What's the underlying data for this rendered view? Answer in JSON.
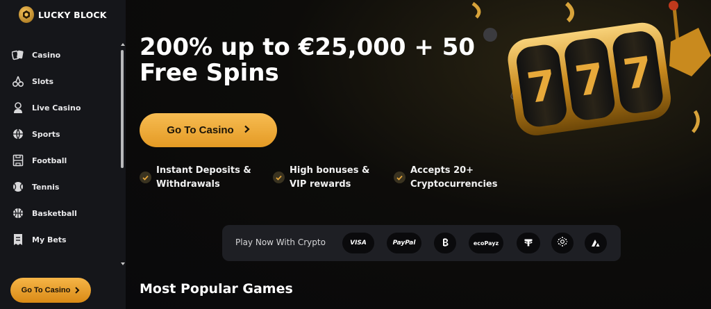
{
  "sidebar": {
    "logo_text": "LUCKY BLOCK",
    "items": [
      {
        "label": "Casino",
        "icon": "cards-icon"
      },
      {
        "label": "Slots",
        "icon": "cherries-icon"
      },
      {
        "label": "Live Casino",
        "icon": "dealer-icon"
      },
      {
        "label": "Sports",
        "icon": "globe-icon"
      },
      {
        "label": "Football",
        "icon": "football-pitch-icon"
      },
      {
        "label": "Tennis",
        "icon": "tennis-ball-icon"
      },
      {
        "label": "Basketball",
        "icon": "basketball-icon"
      },
      {
        "label": "My Bets",
        "icon": "bet-slip-icon"
      }
    ],
    "cta_label": "Go To Casino"
  },
  "hero": {
    "title_line1": "200% up to €25,000 + 50",
    "title_line2": "Free Spins",
    "cta_label": "Go To Casino",
    "features": [
      {
        "line1": "Instant Deposits &",
        "line2": "Withdrawals"
      },
      {
        "line1": "High bonuses &",
        "line2": "VIP rewards"
      },
      {
        "line1": "Accepts 20+",
        "line2": "Cryptocurrencies"
      }
    ]
  },
  "payments": {
    "label": "Play Now With Crypto",
    "methods": [
      "VISA",
      "PayPal",
      "Bitcoin",
      "ecoPayz",
      "Tether",
      "Cardano",
      "Avalanche"
    ],
    "visa_text": "VISA",
    "paypal_text": "PayPal",
    "ecopayz_text": "ecoPayz"
  },
  "sections": {
    "popular_title": "Most Popular Games"
  },
  "colors": {
    "accent": "#f2a93b",
    "sidebar_bg": "#15161a",
    "page_bg": "#0b0b0d"
  }
}
